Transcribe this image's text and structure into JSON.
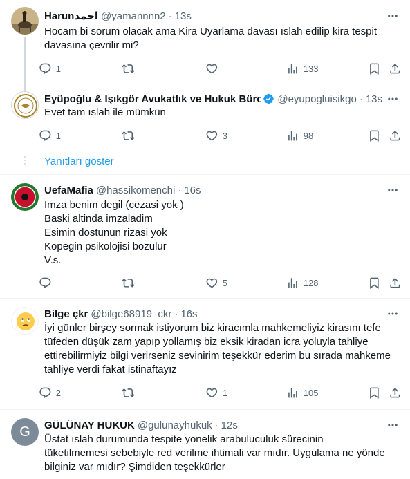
{
  "tweets": [
    {
      "name": "Harunاحمد",
      "handle": "@yamannnn2",
      "time": "13s",
      "text_lines": [
        "Hocam bi sorum olacak ama Kira Uyarlama davası ıslah edilip kira tespit",
        "davasına çevrilir mi?"
      ],
      "replies": "1",
      "retweets": "",
      "likes": "",
      "views": "133"
    },
    {
      "name": "Eyüpoğlu & Işıkgör Avukatlık ve Hukuk Bürosu",
      "handle": "@eyupogluisikgo",
      "time": "13s",
      "text_lines": [
        "Evet tam ıslah ile mümkün"
      ],
      "replies": "1",
      "retweets": "",
      "likes": "3",
      "views": "98"
    },
    {
      "name": "UefaMafia",
      "handle": "@hassikomenchi",
      "time": "16s",
      "text_lines": [
        "Imza benim degil (cezasi yok )",
        "Baski altinda imzaladim",
        "Esimin dostunun rizasi yok",
        "Kopegin psikolojisi bozulur",
        "V.s."
      ],
      "replies": "",
      "retweets": "",
      "likes": "5",
      "views": "128"
    },
    {
      "name": "Bilge çkr",
      "handle": "@bilge68919_ckr",
      "time": "16s",
      "text_lines": [
        "İyi günler birşey sormak istiyorum biz kiracımla mahkemeliyiz kirasını tefe",
        "tüfeden düşük zam yapıp yollamış biz eksik kiradan icra yoluyla tahliye",
        "ettirebilirmiyiz bilgi verirseniz sevinirim teşekkür ederim bu sırada mahkeme",
        "tahliye verdi fakat istinaftayız"
      ],
      "replies": "2",
      "retweets": "",
      "likes": "1",
      "views": "105"
    },
    {
      "name": "GÜLÜNAY HUKUK",
      "handle": "@gulunayhukuk",
      "time": "12s",
      "text_lines": [
        "Üstat ıslah durumunda tespite yonelik arabuluculuk sürecinin",
        "tüketilmemesi sebebiyle red verilme ihtimali var mıdır. Uygulama ne yönde",
        "bilginiz var mıdır? Şimdiden teşekkürler"
      ],
      "replies": "",
      "retweets": "",
      "likes": "",
      "views": ""
    }
  ],
  "show_replies_label": "Yanıtları göster",
  "avatar_letter_g": "G",
  "colors": {
    "accent": "#1d9bf0",
    "muted": "#536471",
    "text": "#0f1419",
    "divider": "#eff3f4",
    "avatar_g_bg": "#7d8b99"
  }
}
